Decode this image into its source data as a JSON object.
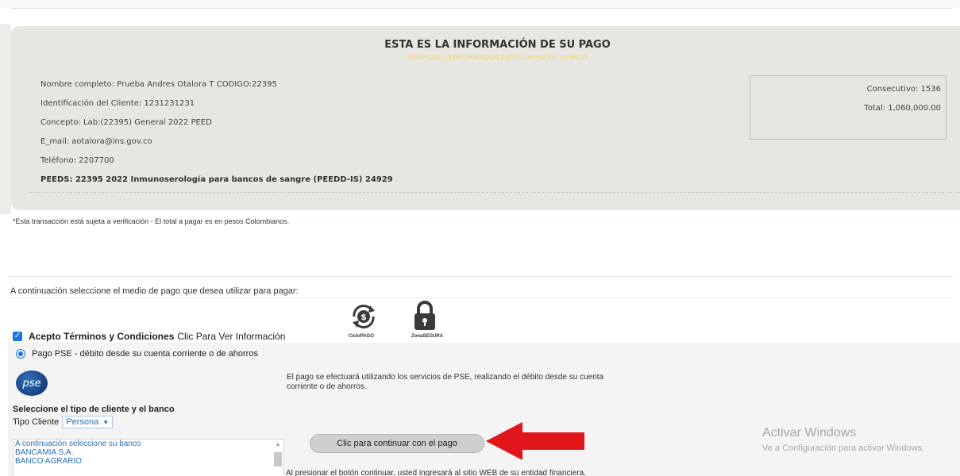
{
  "payment_info": {
    "title": "ESTA ES LA INFORMACIÓN DE SU PAGO",
    "subtitle": "VERIFIQUE LA INFORMACIÓN ANTES DE HACER SU PAGO",
    "lines": [
      "Nombre completo: Prueba Andres Otalora T CODIGO:22395",
      "Identificación del Cliente: 1231231231",
      "Concepto: Lab:(22395) General 2022 PEED",
      "E_mail: aotalora@ins.gov.co",
      "Teléfono: 2207700"
    ],
    "peeds_line": "PEEDS: 22395 2022 Inmunoserología para bancos de sangre (PEEDD-IS)  24929"
  },
  "summary": {
    "consecutivo": "Consecutivo: 1536",
    "total": "Total: 1,060,000.00"
  },
  "disclaimer": "*Esta transacción está sujeta a verificación - El total a pagar es en pesos Colombianos.",
  "select_method": "A continuación seleccione el medio de pago que desea utilizar para pagar:",
  "icons": {
    "ciclopago_label": "CicloPAGO",
    "zonasegura_label": "ZonaSEGURA"
  },
  "terms": {
    "checked": true,
    "bold_label": "Acepto Términos y Condiciones",
    "link_label": "Clic Para Ver Información"
  },
  "pse": {
    "option_label": "Pago PSE - débito desde su cuenta corriente o de ahorros",
    "logo_text": "pse",
    "description": "El pago se efectuará utilizando los servicios de PSE, realizando el débito desde su cuenta corriente o de ahorros.",
    "bank_heading": "Seleccione el tipo de cliente y el banco",
    "client_type_label": "Tipo Cliente",
    "client_type_value": "Persona",
    "banks": [
      "A continuación seleccione su banco",
      "BANCAMIA S.A.",
      "BANCO AGRARIO"
    ],
    "continue_label": "Clic para continuar con el pago",
    "redirect_note": "Al presionar el botón continuar, usted ingresará al sitio WEB de su entidad financiera."
  },
  "windows_watermark": {
    "title": "Activar Windows",
    "subtitle": "Ve a Configuración para activar Windows."
  },
  "colors": {
    "panel_bg": "#e8e6e1",
    "link_blue": "#2a6ebb",
    "arrow_red": "#e0161b",
    "subtitle_yellow": "#f5d66a"
  }
}
